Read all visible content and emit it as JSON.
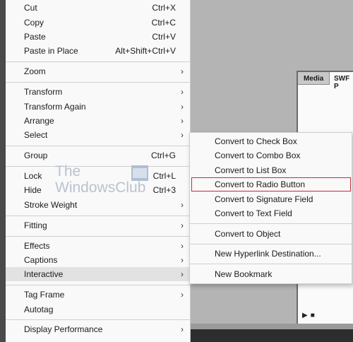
{
  "background_panel": {
    "tabs": [
      "Media",
      "SWF P"
    ],
    "controls": [
      "play-icon",
      "stop-icon"
    ]
  },
  "menu": {
    "items": [
      {
        "label": "Cut",
        "shortcut": "Ctrl+X",
        "submenu": false
      },
      {
        "label": "Copy",
        "shortcut": "Ctrl+C",
        "submenu": false
      },
      {
        "label": "Paste",
        "shortcut": "Ctrl+V",
        "submenu": false
      },
      {
        "label": "Paste in Place",
        "shortcut": "Alt+Shift+Ctrl+V",
        "submenu": false
      },
      {
        "label": "Zoom",
        "shortcut": "",
        "submenu": true
      },
      {
        "label": "Transform",
        "shortcut": "",
        "submenu": true
      },
      {
        "label": "Transform Again",
        "shortcut": "",
        "submenu": true
      },
      {
        "label": "Arrange",
        "shortcut": "",
        "submenu": true
      },
      {
        "label": "Select",
        "shortcut": "",
        "submenu": true
      },
      {
        "label": "Group",
        "shortcut": "Ctrl+G",
        "submenu": false
      },
      {
        "label": "Lock",
        "shortcut": "Ctrl+L",
        "submenu": false
      },
      {
        "label": "Hide",
        "shortcut": "Ctrl+3",
        "submenu": false
      },
      {
        "label": "Stroke Weight",
        "shortcut": "",
        "submenu": true
      },
      {
        "label": "Fitting",
        "shortcut": "",
        "submenu": true
      },
      {
        "label": "Effects",
        "shortcut": "",
        "submenu": true
      },
      {
        "label": "Captions",
        "shortcut": "",
        "submenu": true
      },
      {
        "label": "Interactive",
        "shortcut": "",
        "submenu": true,
        "highlighted": true
      },
      {
        "label": "Tag Frame",
        "shortcut": "",
        "submenu": true
      },
      {
        "label": "Autotag",
        "shortcut": "",
        "submenu": false
      },
      {
        "label": "Display Performance",
        "shortcut": "",
        "submenu": true
      }
    ]
  },
  "submenu": {
    "items": [
      {
        "label": "Convert to Check Box"
      },
      {
        "label": "Convert to Combo Box"
      },
      {
        "label": "Convert to List Box"
      },
      {
        "label": "Convert to Radio Button",
        "outlined": true
      },
      {
        "label": "Convert to Signature Field"
      },
      {
        "label": "Convert to Text Field"
      },
      {
        "label": "Convert to Object"
      },
      {
        "label": "New Hyperlink Destination..."
      },
      {
        "label": "New Bookmark"
      }
    ]
  },
  "watermark": {
    "line1": "The",
    "line2": "WindowsClub"
  },
  "colors": {
    "menu_bg": "#f9f9f9",
    "highlight": "#e2e2e2",
    "outline_red": "#c8283c",
    "separator": "#cfcfcf"
  },
  "icons": {
    "submenu_arrow": "chevron-right-icon",
    "watermark_logo": "windowsclub-logo-icon"
  }
}
